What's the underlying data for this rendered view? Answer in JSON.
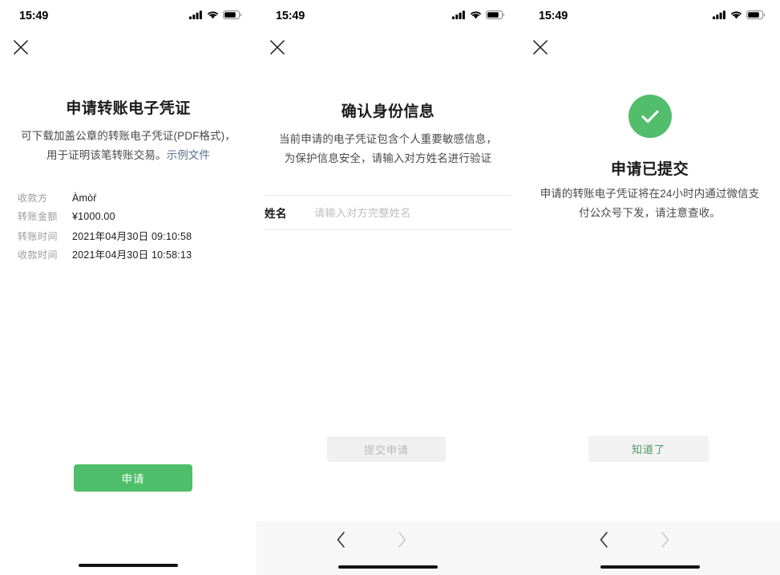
{
  "status_bar": {
    "time": "15:49",
    "signal_icon": "cellular-signal-icon",
    "wifi_icon": "wifi-icon",
    "battery_icon": "battery-icon"
  },
  "colors": {
    "primary_green": "#4FBE6A",
    "success_green": "#52BD6B",
    "ghost_text_green": "#4a9c5f",
    "link_blue": "#5a6f8c",
    "disabled_gray": "#f0f0f0",
    "browser_bar_gray": "#f7f7f7"
  },
  "panel1": {
    "close_label": "✕",
    "title": "申请转账电子凭证",
    "desc_line1": "可下载加盖公章的转账电子凭证(PDF格式)，",
    "desc_line2": "用于证明该笔转账交易。",
    "sample_link": "示例文件",
    "details": [
      {
        "label": "收款方",
        "value": "Àmòŕ"
      },
      {
        "label": "转账金额",
        "value": "¥1000.00"
      },
      {
        "label": "转账时间",
        "value": "2021年04月30日  09:10:58"
      },
      {
        "label": "收款时间",
        "value": "2021年04月30日  10:58:13"
      }
    ],
    "apply_button": "申请"
  },
  "panel2": {
    "close_label": "✕",
    "title": "确认身份信息",
    "desc_line1": "当前申请的电子凭证包含个人重要敏感信息，",
    "desc_line2": "为保护信息安全，请输入对方姓名进行验证",
    "name_field": {
      "label": "姓名",
      "value": "",
      "placeholder": "请输入对方完整姓名"
    },
    "submit_button": "提交申请",
    "nav": {
      "back_icon": "chevron-left-icon",
      "forward_icon": "chevron-right-icon"
    }
  },
  "panel3": {
    "close_label": "✕",
    "success_icon": "check-circle-icon",
    "title": "申请已提交",
    "desc_line1": "申请的转账电子凭证将在24小时内通过微信支",
    "desc_line2": "付公众号下发，请注意查收。",
    "confirm_button": "知道了",
    "nav": {
      "back_icon": "chevron-left-icon",
      "forward_icon": "chevron-right-icon"
    }
  }
}
